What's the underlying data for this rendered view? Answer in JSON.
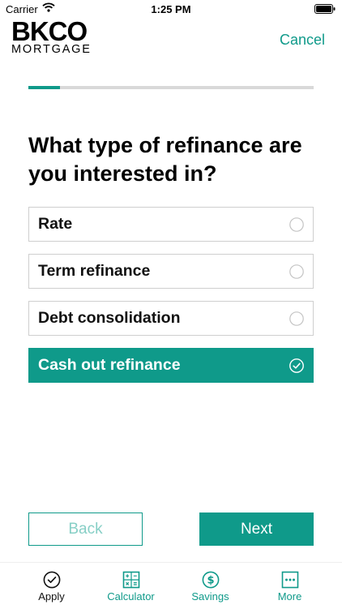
{
  "status": {
    "carrier": "Carrier",
    "time": "1:25 PM"
  },
  "header": {
    "brand": "BKCO",
    "brand_sub": "MORTGAGE",
    "cancel_label": "Cancel"
  },
  "progress": {
    "fraction": 0.11
  },
  "question": "What type of refinance are you interested in?",
  "options": [
    {
      "label": "Rate",
      "selected": false
    },
    {
      "label": "Term refinance",
      "selected": false
    },
    {
      "label": "Debt consolidation",
      "selected": false
    },
    {
      "label": "Cash out refinance",
      "selected": true
    }
  ],
  "buttons": {
    "back": "Back",
    "next": "Next"
  },
  "tabs": [
    {
      "label": "Apply",
      "icon": "check-circle-icon",
      "active": true
    },
    {
      "label": "Calculator",
      "icon": "calculator-icon",
      "active": false
    },
    {
      "label": "Savings",
      "icon": "dollar-circle-icon",
      "active": false
    },
    {
      "label": "More",
      "icon": "more-dots-icon",
      "active": false
    }
  ],
  "colors": {
    "accent": "#0f9a8a",
    "accent_light": "#87cfc6",
    "border": "#cfcfcf",
    "track": "#d9d9d9"
  }
}
